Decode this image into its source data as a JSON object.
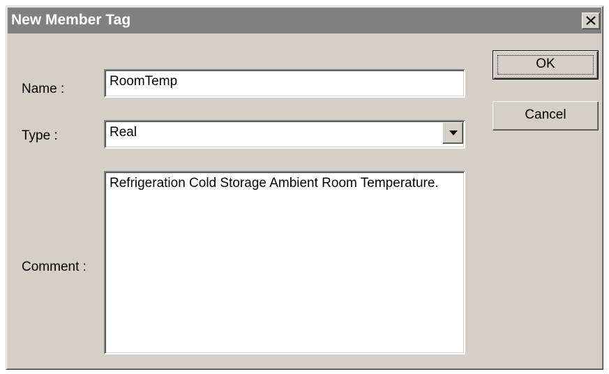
{
  "window": {
    "title": "New Member Tag",
    "close_glyph": "close-icon"
  },
  "form": {
    "name_label": "Name :",
    "name_value": "RoomTemp",
    "type_label": "Type :",
    "type_value": "Real",
    "comment_label": "Comment :",
    "comment_value": "Refrigeration Cold Storage Ambient Room Temperature."
  },
  "buttons": {
    "ok_label": "OK",
    "cancel_label": "Cancel"
  },
  "colors": {
    "face": "#d4d0c8",
    "title_inactive": "#808080",
    "field_bg": "#ffffff"
  }
}
